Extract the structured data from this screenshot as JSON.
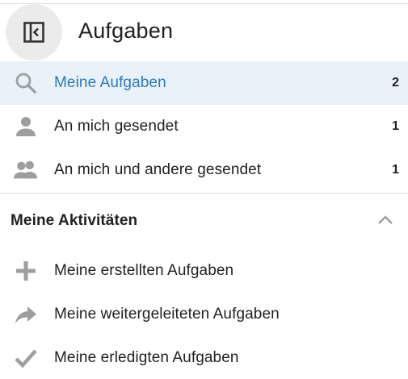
{
  "header": {
    "title": "Aufgaben",
    "toggle_icon": "sidebar-collapse-icon"
  },
  "items": [
    {
      "label": "Meine Aufgaben",
      "count": "2",
      "icon": "search-icon",
      "active": true
    },
    {
      "label": "An mich gesendet",
      "count": "1",
      "icon": "person-icon",
      "active": false
    },
    {
      "label": "An mich und andere gesendet",
      "count": "1",
      "icon": "people-icon",
      "active": false
    }
  ],
  "activities": {
    "title": "Meine Aktivitäten",
    "chevron_icon": "chevron-up-icon",
    "expanded": true,
    "items": [
      {
        "label": "Meine erstellten Aufgaben",
        "icon": "plus-icon"
      },
      {
        "label": "Meine weitergeleiteten Aufgaben",
        "icon": "forward-arrow-icon"
      },
      {
        "label": "Meine erledigten Aufgaben",
        "icon": "check-icon"
      }
    ]
  },
  "colors": {
    "active_background": "#e9f1f9",
    "active_text": "#2e7ab8",
    "icon_gray": "#9e9e9e"
  }
}
